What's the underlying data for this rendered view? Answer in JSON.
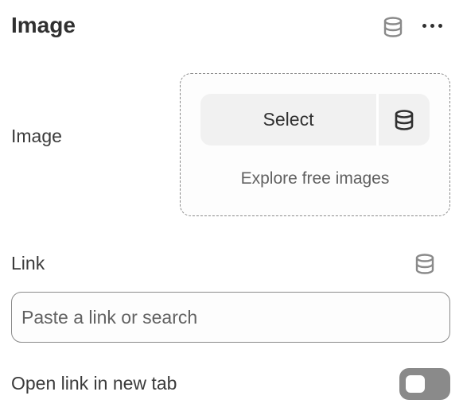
{
  "header": {
    "title": "Image",
    "dynamic_source_icon": "database-icon",
    "more_icon": "more-horizontal-icon"
  },
  "image_field": {
    "label": "Image",
    "select_label": "Select",
    "select_icon": "database-icon",
    "explore_label": "Explore free images"
  },
  "link_field": {
    "label": "Link",
    "dynamic_source_icon": "database-icon",
    "placeholder": "Paste a link or search",
    "value": ""
  },
  "new_tab": {
    "label": "Open link in new tab",
    "enabled": false
  },
  "colors": {
    "text": "#303030",
    "muted": "#616161",
    "icon_gray": "#8a8a8a",
    "button_bg": "#f1f1f1"
  }
}
